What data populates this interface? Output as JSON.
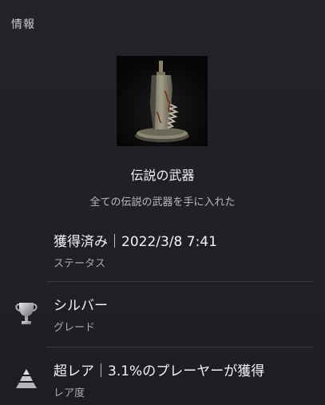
{
  "panel": {
    "title": "情報"
  },
  "trophy": {
    "image_icon": "ruined-sword-monument-image",
    "name": "伝説の武器",
    "description": "全ての伝説の武器を手に入れた"
  },
  "status": {
    "value": "獲得済み｜2022/3/8  7:41",
    "label": "ステータス"
  },
  "grade": {
    "icon": "silver-trophy-cup-icon",
    "value": "シルバー",
    "label": "グレード"
  },
  "rarity": {
    "icon": "rarity-pyramid-icon",
    "value": "超レア｜3.1%のプレーヤーが獲得",
    "label": "レア度"
  }
}
